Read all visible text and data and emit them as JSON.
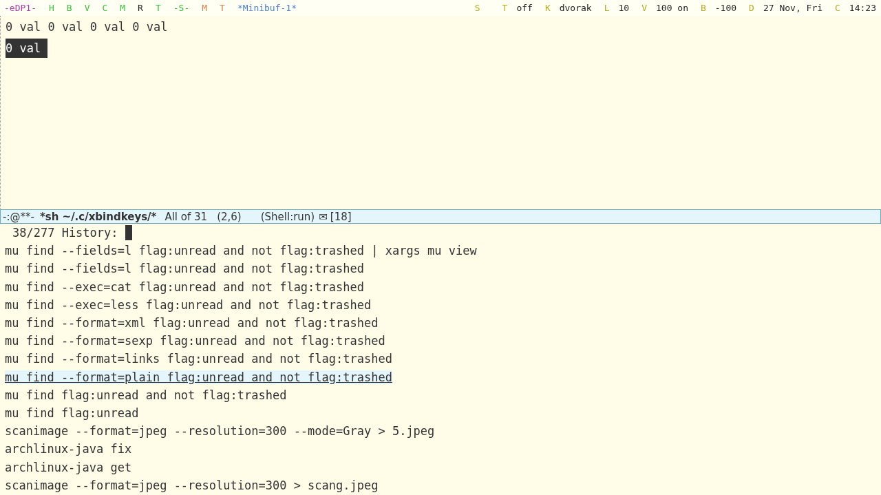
{
  "top_bar": {
    "left": [
      {
        "text": "-eDP1-",
        "color": "#b03cb0"
      },
      {
        "text": "H",
        "color": "#3cc03c"
      },
      {
        "text": "B",
        "color": "#3cc03c"
      },
      {
        "text": "V",
        "color": "#3cc03c"
      },
      {
        "text": "C",
        "color": "#3cc03c"
      },
      {
        "text": "M",
        "color": "#3cc03c"
      },
      {
        "text": "R",
        "color": "#222222"
      },
      {
        "text": "T",
        "color": "#3cc03c"
      },
      {
        "text": "-S-",
        "color": "#3cc03c"
      },
      {
        "text": "M",
        "color": "#d9804a"
      },
      {
        "text": "T",
        "color": "#d9804a"
      },
      {
        "text": "*Minibuf-1*",
        "color": "#4a80d9"
      }
    ],
    "right": [
      {
        "key": "S"
      },
      {
        "key": "T",
        "value": "off"
      },
      {
        "key": "K",
        "value": "dvorak"
      },
      {
        "key": "L",
        "value": "10"
      },
      {
        "key": "V",
        "value": "100 on"
      },
      {
        "key": "B",
        "value": "-100"
      },
      {
        "key": "D",
        "value": "27 Nov, Fri"
      },
      {
        "key": "C",
        "value": "14:23"
      }
    ]
  },
  "buffer": {
    "lines": [
      {
        "text": "0 val 0 val 0 val 0 val",
        "selected": false
      },
      {
        "text": "0 val",
        "selected": true
      }
    ]
  },
  "mode_line": {
    "status": "-:@**-",
    "buffer_name": "*sh ~/.c/xbindkeys/*",
    "position": "All of 31",
    "cursor": "(2,6)",
    "mode": "(Shell:run)",
    "mail_icon": "✉",
    "mail_count": "[18]"
  },
  "minibuffer": {
    "prompt": "38/277 History:",
    "history": [
      {
        "text": "mu find --fields=l flag:unread and not flag:trashed | xargs mu view",
        "selected": false
      },
      {
        "text": "mu find --fields=l flag:unread and not flag:trashed",
        "selected": false
      },
      {
        "text": "mu find --exec=cat flag:unread and not flag:trashed",
        "selected": false
      },
      {
        "text": "mu find --exec=less flag:unread and not flag:trashed",
        "selected": false
      },
      {
        "text": "mu find --format=xml flag:unread and not flag:trashed",
        "selected": false
      },
      {
        "text": "mu find --format=sexp flag:unread and not flag:trashed",
        "selected": false
      },
      {
        "text": "mu find --format=links flag:unread and not flag:trashed",
        "selected": false
      },
      {
        "text": "mu find --format=plain flag:unread and not flag:trashed",
        "selected": true
      },
      {
        "text": "mu find flag:unread and not flag:trashed",
        "selected": false
      },
      {
        "text": "mu find flag:unread",
        "selected": false
      },
      {
        "text": "scanimage --format=jpeg --resolution=300 --mode=Gray > 5.jpeg",
        "selected": false
      },
      {
        "text": "archlinux-java fix",
        "selected": false
      },
      {
        "text": "archlinux-java get",
        "selected": false
      },
      {
        "text": "scanimage --format=jpeg --resolution=300 > scang.jpeg",
        "selected": false
      }
    ]
  }
}
